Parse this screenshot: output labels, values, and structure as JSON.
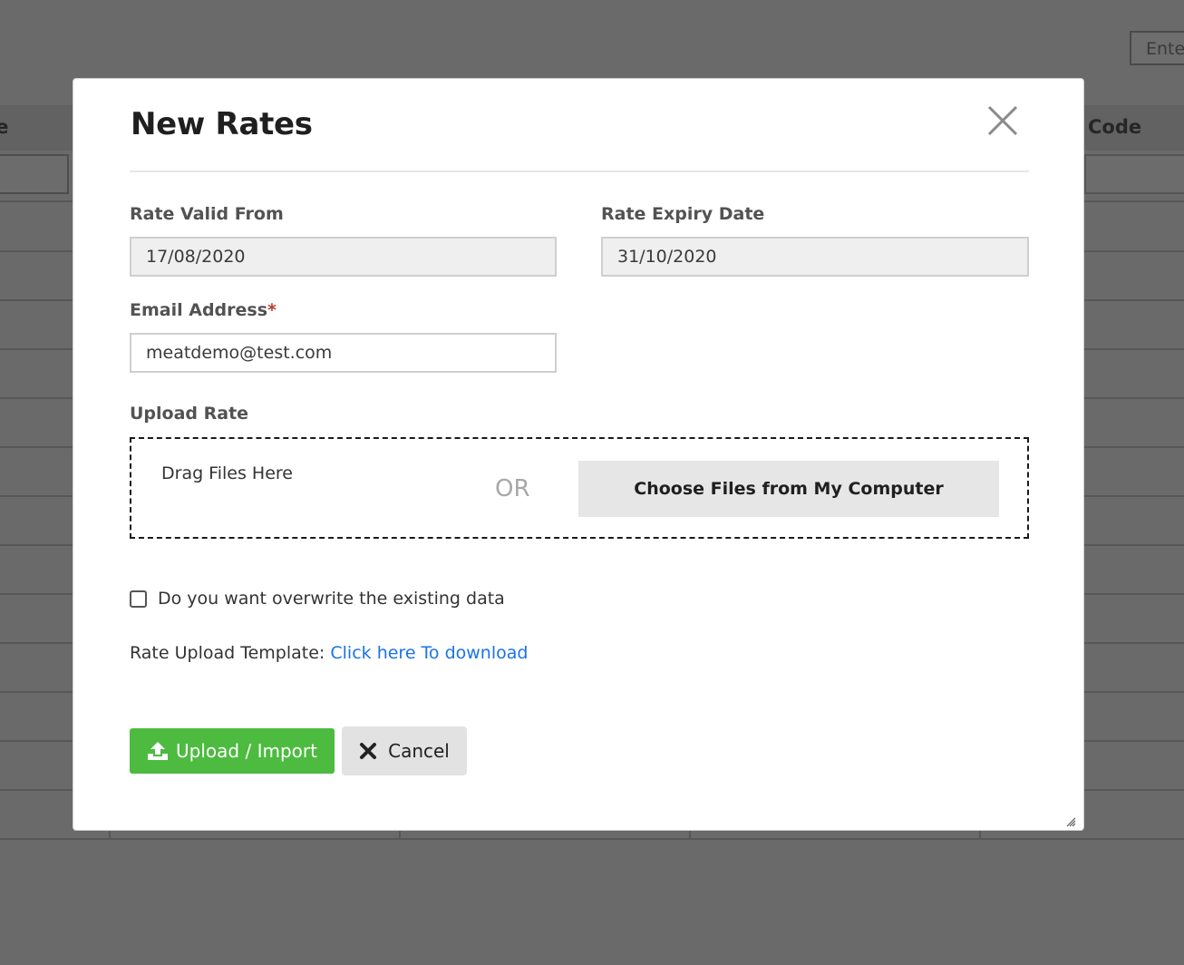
{
  "background": {
    "search_placeholder": "Ente",
    "column_left": "le",
    "column_right": "Code"
  },
  "modal": {
    "title": "New Rates",
    "rate_valid_from": {
      "label": "Rate Valid From",
      "value": "17/08/2020"
    },
    "rate_expiry_date": {
      "label": "Rate Expiry Date",
      "value": "31/10/2020"
    },
    "email": {
      "label": "Email Address",
      "required_mark": "*",
      "value": "meatdemo@test.com"
    },
    "upload": {
      "label": "Upload Rate",
      "drag_text": "Drag Files Here",
      "or_text": "OR",
      "choose_button": "Choose Files from My Computer"
    },
    "overwrite_checkbox": {
      "label": "Do you want overwrite the existing data",
      "checked": false
    },
    "template": {
      "label": "Rate Upload Template:",
      "link_text": "Click here To download"
    },
    "buttons": {
      "upload_import": "Upload / Import",
      "cancel": "Cancel"
    }
  },
  "colors": {
    "overlay": "#6a6a6a",
    "upload_button": "#4cbb3f",
    "link": "#1a73e8",
    "required": "#c0392b"
  }
}
